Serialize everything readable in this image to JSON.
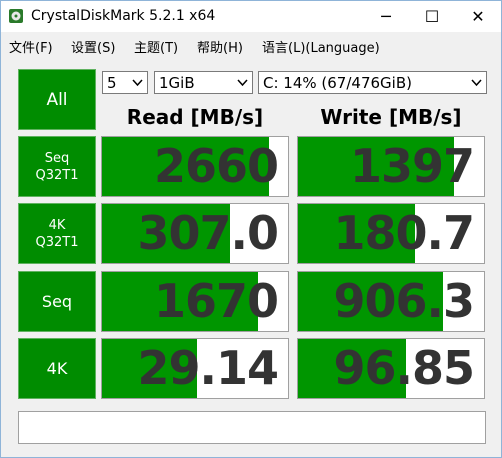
{
  "window": {
    "title": "CrystalDiskMark 5.2.1 x64",
    "minimize": "─",
    "maximize": "☐",
    "close": "✕"
  },
  "menu": [
    {
      "label": "文件(F)"
    },
    {
      "label": "设置(S)"
    },
    {
      "label": "主题(T)"
    },
    {
      "label": "帮助(H)"
    },
    {
      "label": "语言(L)(Language)"
    }
  ],
  "controls": {
    "all_label": "All",
    "count": "5",
    "size": "1GiB",
    "drive": "C: 14% (67/476GiB)"
  },
  "headers": {
    "read": "Read [MB/s]",
    "write": "Write [MB/s]"
  },
  "rows": [
    {
      "label1": "Seq",
      "label2": "Q32T1",
      "read": "2660",
      "write": "1397",
      "read_fill": 0.9,
      "write_fill": 0.84
    },
    {
      "label1": "4K",
      "label2": "Q32T1",
      "read": "307.0",
      "write": "180.7",
      "read_fill": 0.69,
      "write_fill": 0.63
    },
    {
      "label1": "Seq",
      "label2": "",
      "read": "1670",
      "write": "906.3",
      "read_fill": 0.84,
      "write_fill": 0.78
    },
    {
      "label1": "4K",
      "label2": "",
      "read": "29.14",
      "write": "96.85",
      "read_fill": 0.51,
      "write_fill": 0.58
    }
  ],
  "comment": "",
  "colors": {
    "button_green": "#008c00",
    "bar_green": "#009600",
    "value_text": "#333333"
  }
}
